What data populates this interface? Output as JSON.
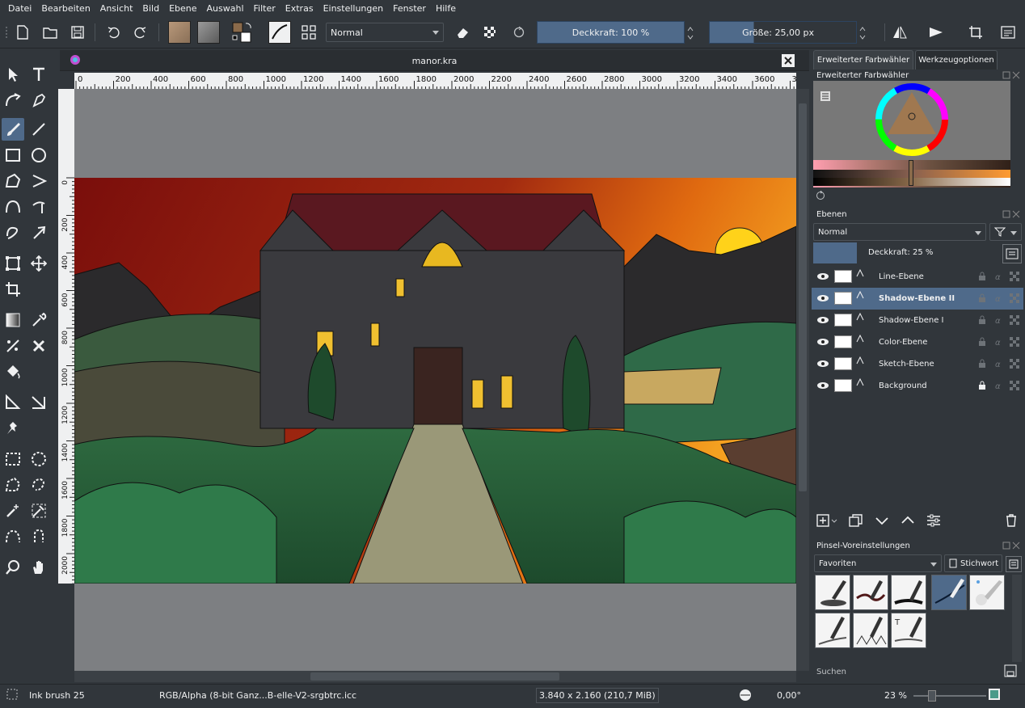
{
  "menu": [
    "Datei",
    "Bearbeiten",
    "Ansicht",
    "Bild",
    "Ebene",
    "Auswahl",
    "Filter",
    "Extras",
    "Einstellungen",
    "Fenster",
    "Hilfe"
  ],
  "toolbar": {
    "blend_mode": "Normal",
    "opacity_label": "Deckkraft: 100 %",
    "size_label": "Größe: 25,00 px"
  },
  "document": {
    "title": "manor.kra"
  },
  "ruler_h": [
    "0",
    "200",
    "400",
    "600",
    "800",
    "1000",
    "1200",
    "1400",
    "1600",
    "1800",
    "2000",
    "2200",
    "2400",
    "2600",
    "2800",
    "3000",
    "3200",
    "3400",
    "3600",
    "3800"
  ],
  "ruler_v": [
    "0",
    "200",
    "400",
    "600",
    "800",
    "1000",
    "1200",
    "1400",
    "1600",
    "1800",
    "2000"
  ],
  "docker": {
    "tab_color": "Erweiterter Farbwähler",
    "tab_tool": "Werkzeugoptionen",
    "color_title": "Erweiterter Farbwähler",
    "layers_title": "Ebenen",
    "layers_blend": "Normal",
    "layers_opacity": "Deckkraft:  25 %",
    "layers": [
      {
        "name": "Line-Ebene",
        "selected": false
      },
      {
        "name": "Shadow-Ebene II",
        "selected": true
      },
      {
        "name": "Shadow-Ebene I",
        "selected": false
      },
      {
        "name": "Color-Ebene",
        "selected": false
      },
      {
        "name": "Sketch-Ebene",
        "selected": false
      },
      {
        "name": "Background",
        "selected": false
      }
    ],
    "brush_title": "Pinsel-Voreinstellungen",
    "brush_filter": "Favoriten",
    "brush_tag": "Stichwort",
    "search_label": "Suchen"
  },
  "status": {
    "brush": "Ink brush 25",
    "color_profile": "RGB/Alpha (8-bit Ganz...B-elle-V2-srgbtrc.icc",
    "dimensions": "3.840 x 2.160 (210,7 MiB)",
    "rotation": "0,00°",
    "zoom": "23 %"
  },
  "colors": {
    "accent": "#4f6a8a",
    "bg": "#31363b",
    "fg_color": "#8a6a4a"
  }
}
